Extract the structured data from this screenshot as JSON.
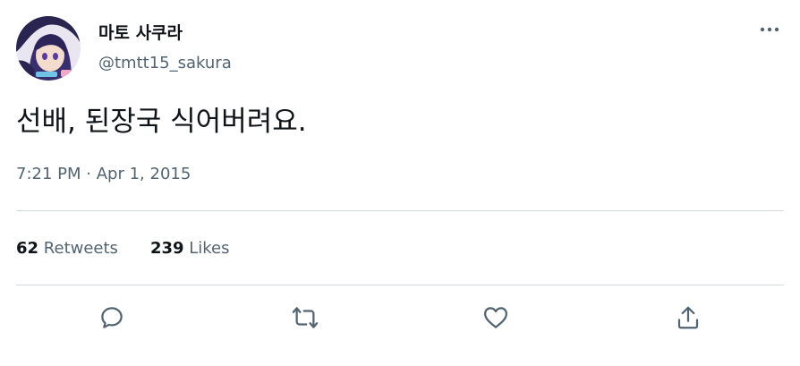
{
  "author": {
    "display_name": "마토 사쿠라",
    "handle": "@tmtt15_sakura",
    "avatar_icon": "profile-avatar"
  },
  "tweet": {
    "text": "선배, 된장국 식어버려요.",
    "time": "7:21 PM",
    "separator": "·",
    "date": "Apr 1, 2015"
  },
  "stats": {
    "retweets_count": "62",
    "retweets_label": "Retweets",
    "likes_count": "239",
    "likes_label": "Likes"
  },
  "actions": {
    "reply_icon": "reply-icon",
    "retweet_icon": "retweet-icon",
    "like_icon": "heart-icon",
    "share_icon": "share-icon"
  },
  "colors": {
    "primary_text": "#0f1419",
    "secondary_text": "#536471",
    "divider": "#cfd9de"
  }
}
